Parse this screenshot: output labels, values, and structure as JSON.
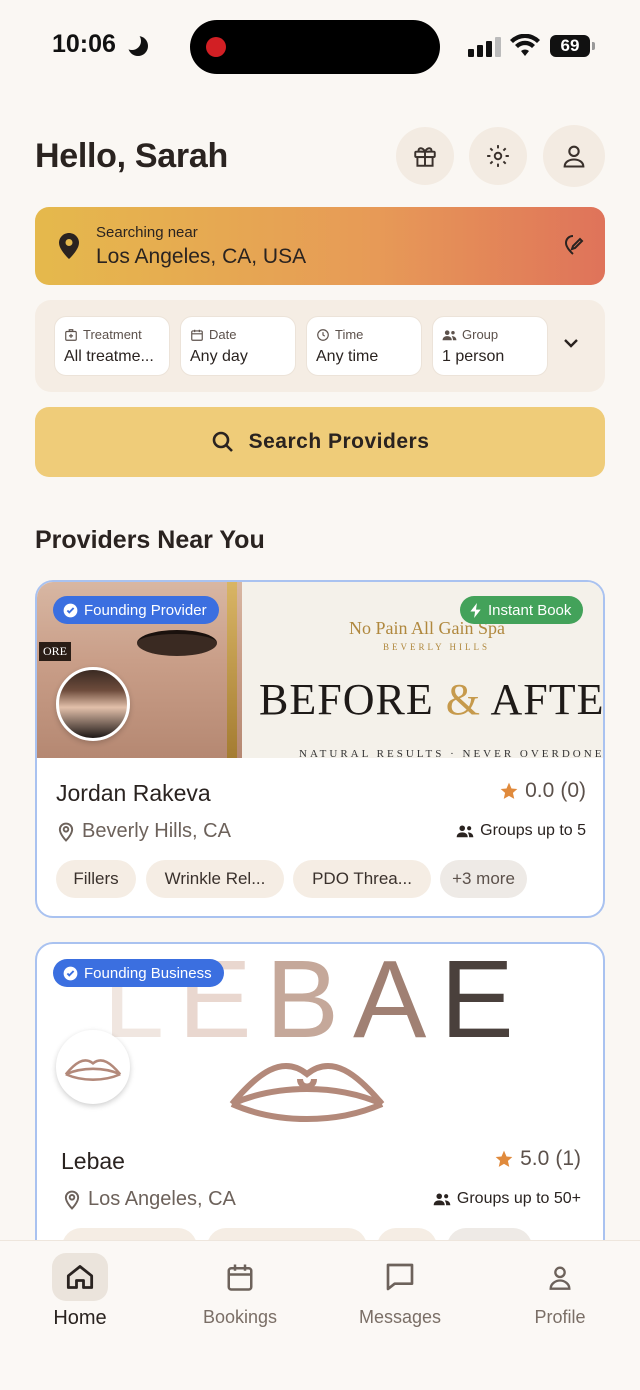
{
  "status_bar": {
    "time": "10:06",
    "battery": "69"
  },
  "header": {
    "greeting": "Hello, Sarah"
  },
  "location": {
    "caption": "Searching near",
    "value": "Los Angeles, CA, USA"
  },
  "filters": [
    {
      "label": "Treatment",
      "value": "All treatme...",
      "icon": "medkit-icon"
    },
    {
      "label": "Date",
      "value": "Any day",
      "icon": "calendar-icon"
    },
    {
      "label": "Time",
      "value": "Any time",
      "icon": "clock-icon"
    },
    {
      "label": "Group",
      "value": "1 person",
      "icon": "group-icon"
    }
  ],
  "search_button": "Search Providers",
  "section_title": "Providers Near You",
  "providers": [
    {
      "badge": "Founding Provider",
      "instant": "Instant Book",
      "banner": {
        "spa_name": "No Pain All Gain Spa",
        "spa_sub": "BEVERLY HILLS",
        "headline_a": "BEFORE ",
        "headline_amp": "&",
        "headline_b": " AFTER",
        "tagline": "NATURAL RESULTS · NEVER OVERDONE",
        "corner": "ORE"
      },
      "name": "Jordan Rakeva",
      "rating": "0.0",
      "reviews": "(0)",
      "location": "Beverly Hills, CA",
      "groups": "Groups up to 5",
      "tags": [
        "Fillers",
        "Wrinkle Rel...",
        "PDO Threa...",
        "+3 more"
      ]
    },
    {
      "badge": "Founding Business",
      "banner_letters": "LEBAE",
      "name": "Lebae",
      "rating": "5.0",
      "reviews": "(1)",
      "location": "Los Angeles, CA",
      "groups": "Groups up to 50+"
    }
  ],
  "nav": [
    {
      "label": "Home",
      "icon": "home-icon"
    },
    {
      "label": "Bookings",
      "icon": "calendar-icon"
    },
    {
      "label": "Messages",
      "icon": "message-icon"
    },
    {
      "label": "Profile",
      "icon": "profile-icon"
    }
  ],
  "colors": {
    "accent_yellow": "#efcc79",
    "badge_blue": "#3b6fe0",
    "badge_green": "#43a25a",
    "star": "#e08a3c",
    "card_border": "#a9c2f0"
  }
}
